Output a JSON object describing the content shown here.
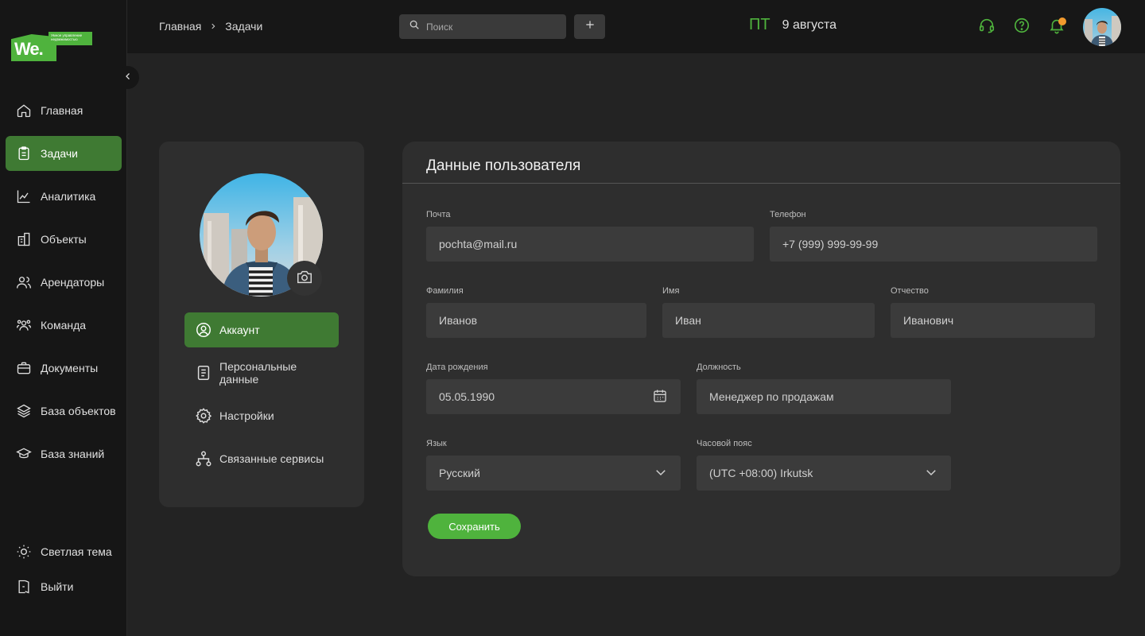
{
  "logo": {
    "text": "We.",
    "tagline": "Умное управление недвижимостью"
  },
  "sidebar": {
    "items": [
      {
        "label": "Главная",
        "icon": "home-icon"
      },
      {
        "label": "Задачи",
        "icon": "clipboard-icon",
        "active": true
      },
      {
        "label": "Аналитика",
        "icon": "chart-icon"
      },
      {
        "label": "Объекты",
        "icon": "building-icon"
      },
      {
        "label": "Арендаторы",
        "icon": "users-icon"
      },
      {
        "label": "Команда",
        "icon": "team-icon"
      },
      {
        "label": "Документы",
        "icon": "briefcase-icon"
      },
      {
        "label": "База объектов",
        "icon": "layers-icon"
      },
      {
        "label": "База знаний",
        "icon": "graduation-cap-icon"
      }
    ],
    "bottom": [
      {
        "label": "Светлая тема",
        "icon": "sun-icon"
      },
      {
        "label": "Выйти",
        "icon": "logout-icon"
      }
    ]
  },
  "header": {
    "breadcrumbs": [
      "Главная",
      "Задачи"
    ],
    "search_placeholder": "Поиск",
    "day": "ПТ",
    "date": "9 августа",
    "notification_badge": "1"
  },
  "profile_menu": [
    {
      "label": "Аккаунт",
      "icon": "user-circle-icon",
      "active": true
    },
    {
      "label": "Персональные данные",
      "icon": "document-icon"
    },
    {
      "label": "Настройки",
      "icon": "gear-icon"
    },
    {
      "label": "Связанные сервисы",
      "icon": "network-icon"
    }
  ],
  "form": {
    "title": "Данные пользователя",
    "email": {
      "label": "Почта",
      "value": "pochta@mail.ru"
    },
    "phone": {
      "label": "Телефон",
      "value": "+7 (999) 999-99-99"
    },
    "last_name": {
      "label": "Фамилия",
      "value": "Иванов"
    },
    "first_name": {
      "label": "Имя",
      "value": "Иван"
    },
    "patronymic": {
      "label": "Отчество",
      "value": "Иванович"
    },
    "birth_date": {
      "label": "Дата рождения",
      "value": "05.05.1990"
    },
    "position": {
      "label": "Должность",
      "value": "Менеджер по продажам"
    },
    "language": {
      "label": "Язык",
      "value": "Русский"
    },
    "timezone": {
      "label": "Часовой пояс",
      "value": "(UTC +08:00) Irkutsk"
    },
    "save_label": "Сохранить"
  },
  "colors": {
    "accent": "#4fb33d",
    "active_bg": "#3f7a33",
    "badge": "#f29a2e"
  }
}
